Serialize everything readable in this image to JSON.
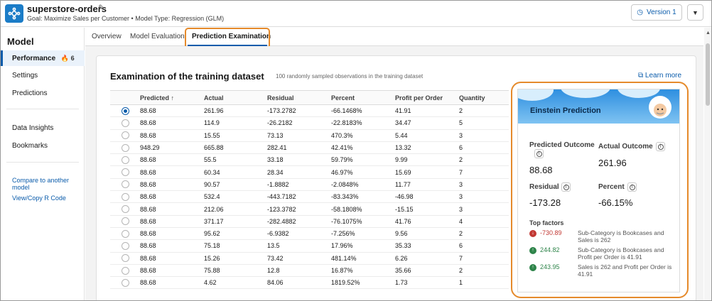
{
  "header": {
    "title": "superstore-orders",
    "goal": "Goal: Maximize Sales per Customer • Model Type: Regression (GLM)",
    "version_label": "Version 1"
  },
  "sidebar": {
    "heading": "Model",
    "items": [
      {
        "label": "Performance",
        "badge": "6"
      },
      {
        "label": "Settings"
      },
      {
        "label": "Predictions"
      },
      {
        "label": "Data Insights"
      },
      {
        "label": "Bookmarks"
      }
    ],
    "links": [
      "Compare to another model",
      "View/Copy R Code"
    ]
  },
  "tabs": [
    "Overview",
    "Model Evaluation",
    "Prediction Examination"
  ],
  "main": {
    "title": "Examination of the training dataset",
    "subtitle": "100 randomly sampled observations in the training dataset",
    "learn_more": "Learn more",
    "columns": [
      "Predicted ↑",
      "Actual",
      "Residual",
      "Percent",
      "Profit per Order",
      "Quantity"
    ],
    "rows": [
      [
        "88.68",
        "261.96",
        "-173.2782",
        "-66.1468%",
        "41.91",
        "2"
      ],
      [
        "88.68",
        "114.9",
        "-26.2182",
        "-22.8183%",
        "34.47",
        "5"
      ],
      [
        "88.68",
        "15.55",
        "73.13",
        "470.3%",
        "5.44",
        "3"
      ],
      [
        "948.29",
        "665.88",
        "282.41",
        "42.41%",
        "13.32",
        "6"
      ],
      [
        "88.68",
        "55.5",
        "33.18",
        "59.79%",
        "9.99",
        "2"
      ],
      [
        "88.68",
        "60.34",
        "28.34",
        "46.97%",
        "15.69",
        "7"
      ],
      [
        "88.68",
        "90.57",
        "-1.8882",
        "-2.0848%",
        "11.77",
        "3"
      ],
      [
        "88.68",
        "532.4",
        "-443.7182",
        "-83.343%",
        "-46.98",
        "3"
      ],
      [
        "88.68",
        "212.06",
        "-123.3782",
        "-58.1808%",
        "-15.15",
        "3"
      ],
      [
        "88.68",
        "371.17",
        "-282.4882",
        "-76.1075%",
        "41.76",
        "4"
      ],
      [
        "88.68",
        "95.62",
        "-6.9382",
        "-7.256%",
        "9.56",
        "2"
      ],
      [
        "88.68",
        "75.18",
        "13.5",
        "17.96%",
        "35.33",
        "6"
      ],
      [
        "88.68",
        "15.26",
        "73.42",
        "481.14%",
        "6.26",
        "7"
      ],
      [
        "88.68",
        "75.88",
        "12.8",
        "16.87%",
        "35.66",
        "2"
      ],
      [
        "88.68",
        "4.62",
        "84.06",
        "1819.52%",
        "1.73",
        "1"
      ]
    ]
  },
  "einstein": {
    "title": "Einstein Prediction",
    "predicted_label": "Predicted Outcome",
    "predicted_value": "88.68",
    "actual_label": "Actual Outcome",
    "actual_value": "261.96",
    "residual_label": "Residual",
    "residual_value": "-173.28",
    "percent_label": "Percent",
    "percent_value": "-66.15%",
    "top_factors_label": "Top factors",
    "factors": [
      {
        "value": "-730.89",
        "direction": "down",
        "desc": "Sub-Category is Bookcases and Sales is 262"
      },
      {
        "value": "244.82",
        "direction": "up",
        "desc": "Sub-Category is Bookcases and Profit per Order is 41.91"
      },
      {
        "value": "243.95",
        "direction": "up",
        "desc": "Sales is 262 and Profit per Order is 41.91"
      }
    ]
  },
  "colors": {
    "accent": "#0b5cab",
    "highlight": "#e58a2b",
    "negative": "#c23934",
    "positive": "#2e844a"
  }
}
